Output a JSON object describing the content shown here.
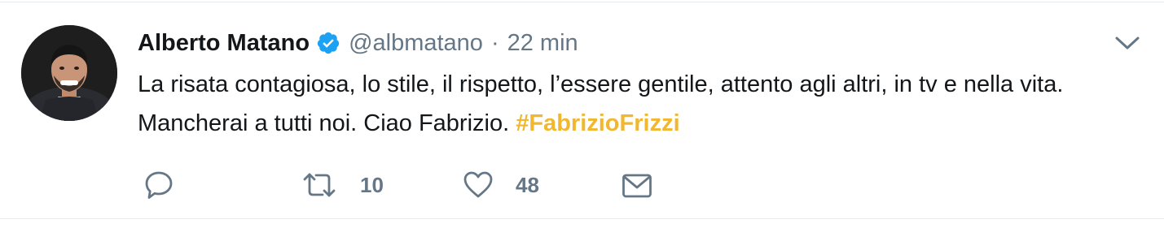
{
  "tweet": {
    "author": {
      "name": "Alberto Matano",
      "handle": "@albmatano",
      "verified": true
    },
    "separator": "·",
    "time": "22 min",
    "text_main": "La risata contagiosa, lo stile, il rispetto, l’essere gentile, attento agli altri, in tv e nella vita.  Mancherai a tutti noi. Ciao Fabrizio. ",
    "hashtag": "#FabrizioFrizzi"
  },
  "actions": {
    "reply": {
      "icon": "reply-icon"
    },
    "retweet": {
      "icon": "retweet-icon",
      "count": "10"
    },
    "like": {
      "icon": "heart-icon",
      "count": "48"
    },
    "message": {
      "icon": "envelope-icon"
    }
  },
  "colors": {
    "text": "#14171a",
    "secondary": "#657786",
    "verified": "#1da1f2",
    "hashtag": "#f0b72f",
    "border": "#e6ecf0"
  }
}
